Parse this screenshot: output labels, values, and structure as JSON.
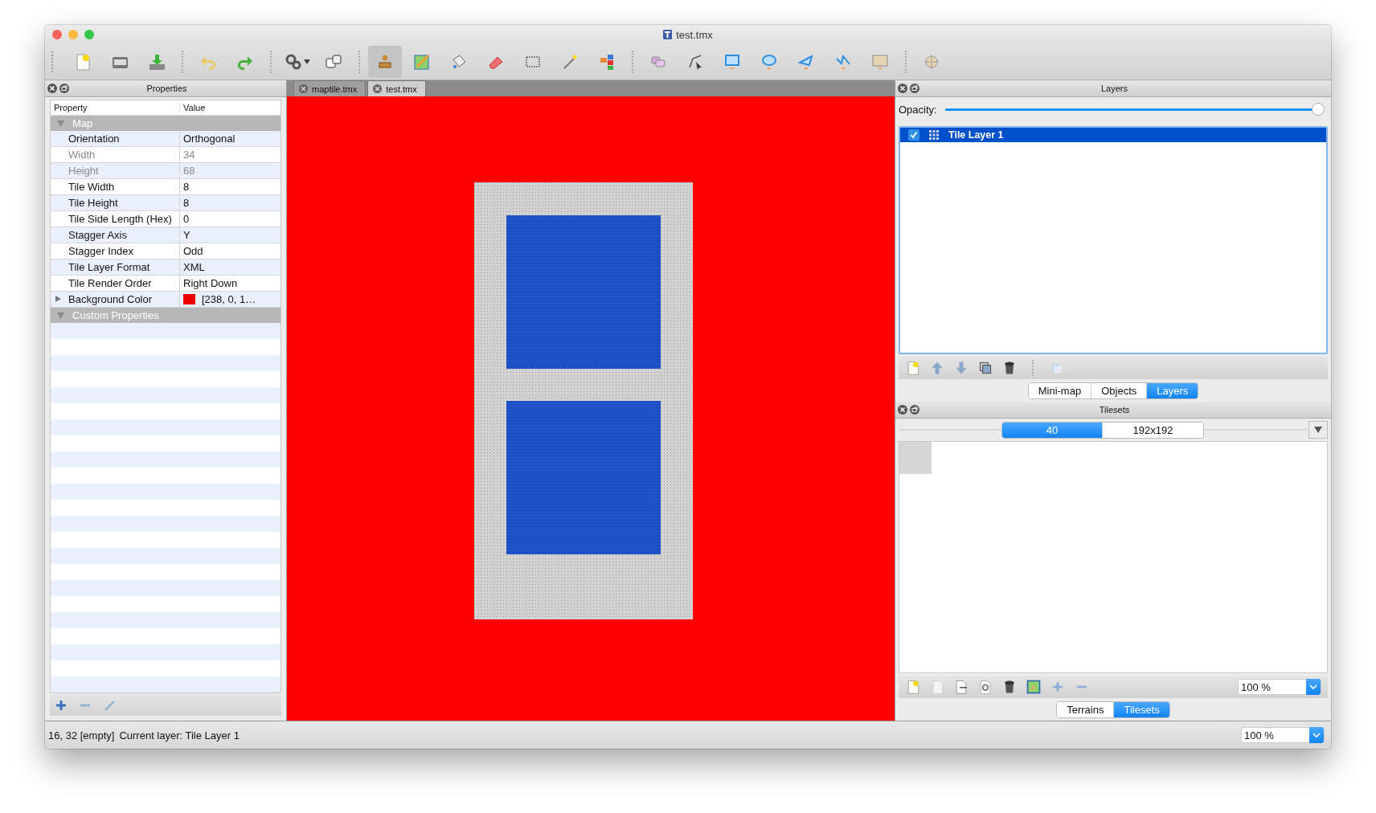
{
  "window": {
    "title": "test.tmx"
  },
  "toolbar": {
    "tools": [
      {
        "selected": false
      },
      {
        "selected": false
      },
      {
        "selected": false
      },
      {
        "selected": false
      },
      {
        "selected": false
      },
      {
        "selected": false
      },
      {
        "selected": false
      },
      {
        "selected": true
      },
      {
        "selected": false
      },
      {
        "selected": false
      },
      {
        "selected": false
      },
      {
        "selected": false
      },
      {
        "selected": false
      },
      {
        "selected": false
      },
      {
        "selected": false
      },
      {
        "selected": false
      },
      {
        "selected": false
      },
      {
        "selected": false
      },
      {
        "selected": false
      },
      {
        "selected": false
      },
      {
        "selected": false
      },
      {
        "selected": false
      }
    ]
  },
  "properties": {
    "title": "Properties",
    "columns": [
      "Property",
      "Value"
    ],
    "groups": [
      {
        "name": "Map",
        "expanded": true,
        "rows": [
          {
            "name": "Orientation",
            "value": "Orthogonal",
            "disabled": false
          },
          {
            "name": "Width",
            "value": "34",
            "disabled": true
          },
          {
            "name": "Height",
            "value": "68",
            "disabled": true
          },
          {
            "name": "Tile Width",
            "value": "8",
            "disabled": false
          },
          {
            "name": "Tile Height",
            "value": "8",
            "disabled": false
          },
          {
            "name": "Tile Side Length (Hex)",
            "value": "0",
            "disabled": false
          },
          {
            "name": "Stagger Axis",
            "value": "Y",
            "disabled": false
          },
          {
            "name": "Stagger Index",
            "value": "Odd",
            "disabled": false
          },
          {
            "name": "Tile Layer Format",
            "value": "XML",
            "disabled": false
          },
          {
            "name": "Tile Render Order",
            "value": "Right Down",
            "disabled": false
          },
          {
            "name": "Background Color",
            "value": "[238, 0, 1…",
            "disabled": false,
            "expanded": false,
            "color": "#ee0001"
          }
        ]
      },
      {
        "name": "Custom Properties",
        "expanded": true
      }
    ]
  },
  "document_tabs": [
    {
      "label": "maptile.tmx",
      "selected": false
    },
    {
      "label": "test.tmx",
      "selected": true
    }
  ],
  "layers": {
    "title": "Layers",
    "opacity_label": "Opacity:",
    "opacity": {
      "level": 1
    },
    "items": [
      {
        "name": "Tile Layer 1",
        "checked": true,
        "selected": true
      }
    ],
    "tabs": [
      {
        "label": "Mini-map",
        "selected": false
      },
      {
        "label": "Objects",
        "selected": false
      },
      {
        "label": "Layers",
        "selected": true
      }
    ]
  },
  "tilesets": {
    "title": "Tilesets",
    "tabs": [
      {
        "label": "40",
        "selected": true
      },
      {
        "label": "192x192",
        "selected": false
      }
    ],
    "zoom": "100 %",
    "bottom_tabs": [
      {
        "label": "Terrains",
        "selected": false
      },
      {
        "label": "Tilesets",
        "selected": true
      }
    ]
  },
  "status_bar": {
    "position": "16, 32 [empty]",
    "current_layer": "Current layer: Tile Layer 1",
    "zoom": "100 %"
  }
}
